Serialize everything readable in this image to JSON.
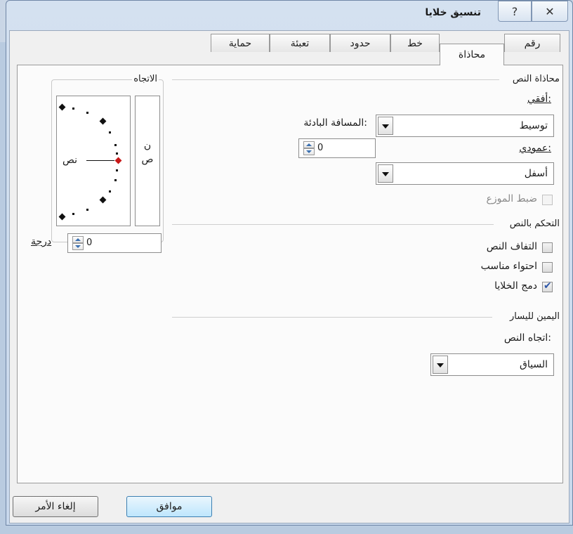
{
  "dialog": {
    "title": "تنسيق خلايا",
    "help_glyph": "?",
    "close_glyph": "✕"
  },
  "tabs": [
    {
      "label": "رقم",
      "active": false
    },
    {
      "label": "محاذاة",
      "active": true
    },
    {
      "label": "خط",
      "active": false
    },
    {
      "label": "حدود",
      "active": false
    },
    {
      "label": "تعبئة",
      "active": false
    },
    {
      "label": "حماية",
      "active": false
    }
  ],
  "text_alignment": {
    "group_label": "محاذاة النص",
    "horizontal_label": "أفقي:",
    "horizontal_value": "توسيط",
    "indent_label": "المسافة البادئة:",
    "indent_value": "0",
    "vertical_label": "عمودي:",
    "vertical_value": "أسفل",
    "justify_distributed_label": "ضبط الموزع",
    "justify_distributed_checked": false
  },
  "orientation": {
    "group_label": "الاتجاه",
    "vertical_text_top": "ن",
    "vertical_text_bottom": "ص",
    "dial_text": "نص",
    "degrees_value": "0",
    "degrees_label": "درجة"
  },
  "text_control": {
    "group_label": "التحكم بالنص",
    "wrap_text_label": "التفاف النص",
    "wrap_text_checked": false,
    "shrink_to_fit_label": "احتواء مناسب",
    "shrink_to_fit_checked": false,
    "merge_cells_label": "دمج الخلايا",
    "merge_cells_checked": true
  },
  "rtl": {
    "group_label": "اليمين لليسار",
    "text_direction_label": "اتجاه النص:",
    "text_direction_value": "السياق"
  },
  "buttons": {
    "ok": "موافق",
    "cancel": "إلغاء الأمر"
  }
}
